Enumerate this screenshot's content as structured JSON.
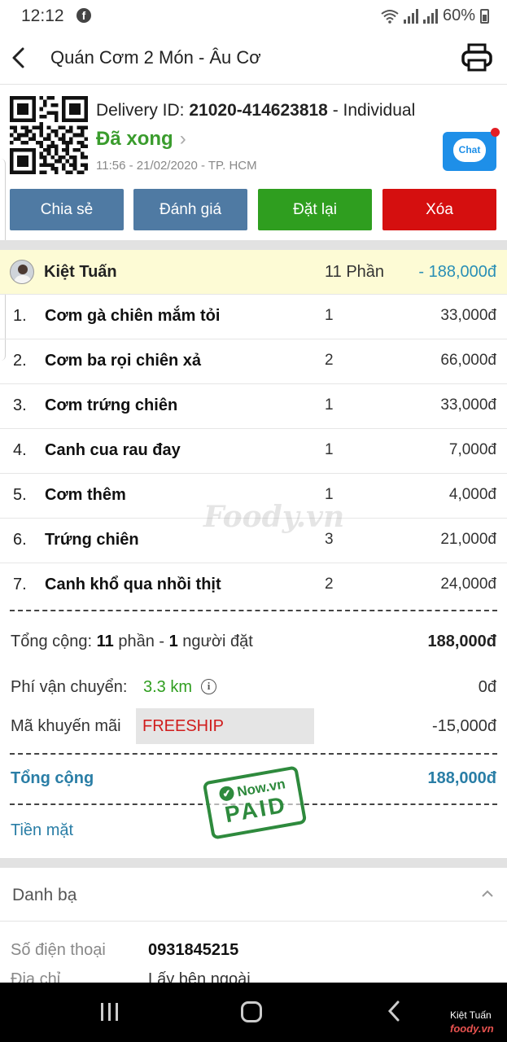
{
  "status_bar": {
    "time": "12:12",
    "facebook_icon": "f",
    "battery": "60%"
  },
  "header": {
    "title": "Quán Cơm 2 Món - Âu Cơ"
  },
  "delivery": {
    "id_label": "Delivery ID: ",
    "id": "21020-414623818",
    "type": " - Individual",
    "status": "Đã xong",
    "meta": "11:56 - 21/02/2020 - TP. HCM",
    "chat_label": "Chat"
  },
  "actions": {
    "share": "Chia sẻ",
    "rate": "Đánh giá",
    "reorder": "Đặt lại",
    "delete": "Xóa"
  },
  "order": {
    "user": {
      "name": "Kiệt Tuấn",
      "qty": "11 Phần",
      "total": "- 188,000đ"
    },
    "items": [
      {
        "num": "1.",
        "name": "Cơm gà chiên mắm tỏi",
        "qty": "1",
        "price": "33,000đ"
      },
      {
        "num": "2.",
        "name": "Cơm ba rọi chiên xả",
        "qty": "2",
        "price": "66,000đ"
      },
      {
        "num": "3.",
        "name": "Cơm trứng chiên",
        "qty": "1",
        "price": "33,000đ"
      },
      {
        "num": "4.",
        "name": "Canh cua rau đay",
        "qty": "1",
        "price": "7,000đ"
      },
      {
        "num": "5.",
        "name": "Cơm thêm",
        "qty": "1",
        "price": "4,000đ"
      },
      {
        "num": "6.",
        "name": "Trứng chiên",
        "qty": "3",
        "price": "21,000đ"
      },
      {
        "num": "7.",
        "name": "Canh khổ qua nhồi thịt",
        "qty": "2",
        "price": "24,000đ"
      }
    ]
  },
  "summary": {
    "subtotal_pre": "Tổng cộng: ",
    "subtotal_count": "11",
    "subtotal_mid": " phần - ",
    "subtotal_people": "1",
    "subtotal_post": " người đặt",
    "subtotal_value": "188,000đ",
    "shipping_label": "Phí vận chuyển:",
    "shipping_distance": "3.3 km",
    "shipping_fee": "0đ",
    "promo_label": "Mã khuyến mãi",
    "promo_code": "FREESHIP",
    "promo_value": "-15,000đ",
    "total_label": "Tổng cộng",
    "total_value": "188,000đ",
    "payment_method": "Tiền mặt"
  },
  "stamp": {
    "brand": "Now.vn",
    "text": "PAID"
  },
  "watermark": "Foody.vn",
  "contacts": {
    "title": "Danh bạ",
    "phone_label": "Số điện thoại",
    "phone_value": "0931845215",
    "address_label": "Địa chỉ",
    "address_value": "Lấy bên ngoài"
  },
  "credit": {
    "name": "Kiệt Tuấn",
    "logo": "foody.vn"
  },
  "colors": {
    "share": "#4f7aa3",
    "reorder": "#2f9e1f",
    "delete": "#d50f0f",
    "status_done": "#3a9c2d",
    "total_accent": "#2a7ea6"
  }
}
